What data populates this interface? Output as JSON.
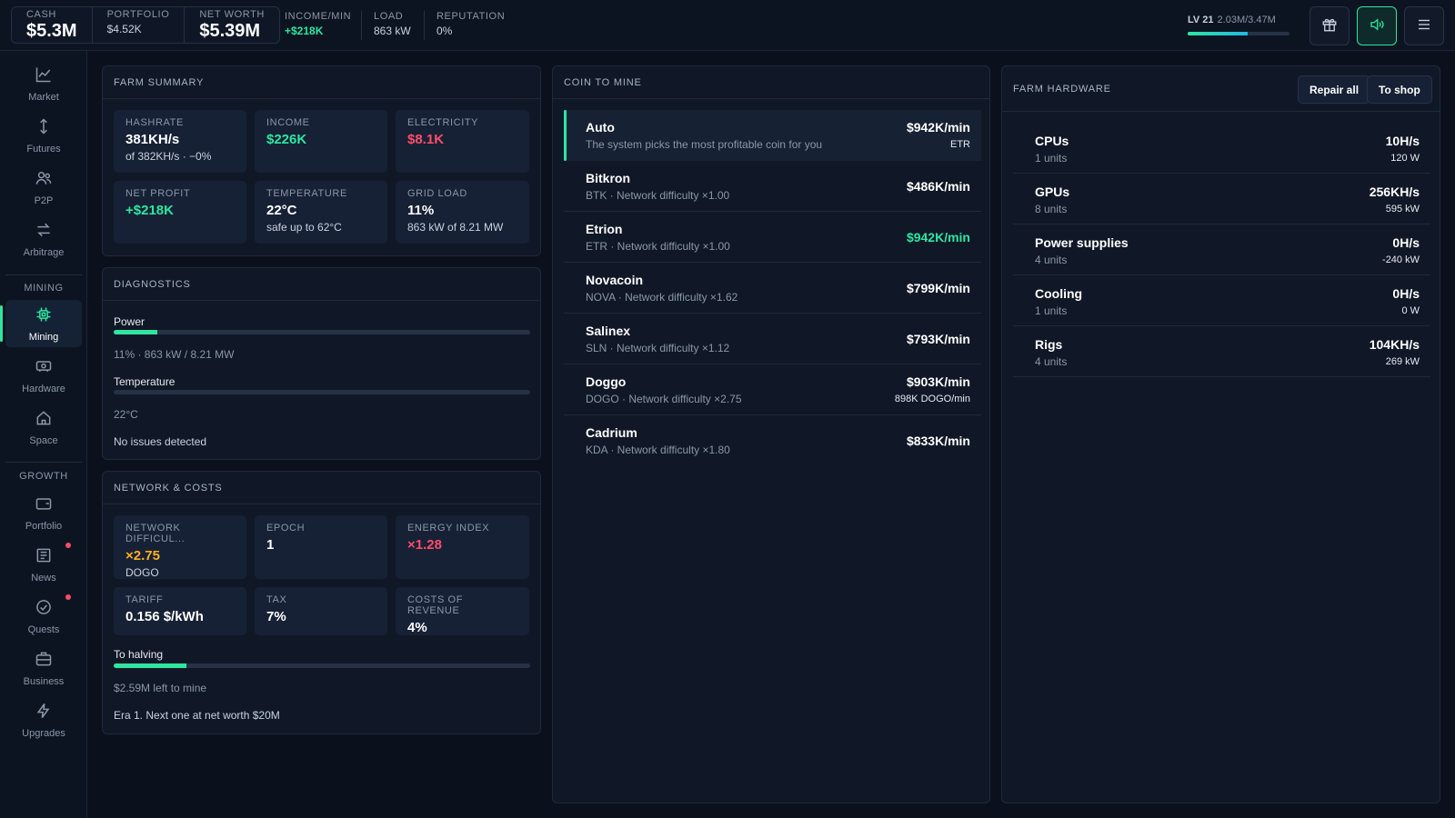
{
  "topbar": {
    "cash_label": "CASH",
    "cash_value": "$5.3M",
    "portfolio_label": "PORTFOLIO",
    "portfolio_value": "$4.52K",
    "networth_label": "NET WORTH",
    "networth_value": "$5.39M",
    "income_label": "INCOME/MIN",
    "income_value": "+$218K",
    "load_label": "LOAD",
    "load_value": "863 kW",
    "reputation_label": "REPUTATION",
    "reputation_value": "0%",
    "level_label": "LV 21",
    "level_xp": "2.03M/3.47M",
    "level_progress": 0.585
  },
  "icons": {
    "gift": "gift-icon",
    "sound": "speaker-icon",
    "menu": "menu-icon"
  },
  "sidebar": {
    "items_top": [
      {
        "label": "Market",
        "icon": "chart-icon"
      },
      {
        "label": "Futures",
        "icon": "arrows-icon"
      },
      {
        "label": "P2P",
        "icon": "users-icon"
      },
      {
        "label": "Arbitrage",
        "icon": "swap-icon"
      }
    ],
    "mining_section": "MINING",
    "items_mining": [
      {
        "label": "Mining",
        "icon": "chip-icon",
        "active": true
      },
      {
        "label": "Hardware",
        "icon": "hardware-icon"
      },
      {
        "label": "Space",
        "icon": "home-icon"
      }
    ],
    "growth_section": "GROWTH",
    "items_growth": [
      {
        "label": "Portfolio",
        "icon": "wallet-icon"
      },
      {
        "label": "News",
        "icon": "news-icon",
        "badge": true
      },
      {
        "label": "Quests",
        "icon": "check-circle-icon",
        "badge": true
      },
      {
        "label": "Business",
        "icon": "briefcase-icon"
      },
      {
        "label": "Upgrades",
        "icon": "bolt-icon"
      }
    ]
  },
  "farm_summary": {
    "title": "FARM SUMMARY",
    "hashrate_label": "HASHRATE",
    "hashrate_value": "381KH/s",
    "hashrate_sub": "of 382KH/s · −0%",
    "income_label": "INCOME",
    "income_value": "$226K",
    "electricity_label": "ELECTRICITY",
    "electricity_value": "$8.1K",
    "netprofit_label": "NET PROFIT",
    "netprofit_value": "+$218K",
    "temperature_label": "TEMPERATURE",
    "temperature_value": "22°C",
    "temperature_sub": "safe up to 62°C",
    "gridload_label": "GRID LOAD",
    "gridload_value": "11%",
    "gridload_sub": "863 kW of 8.21 MW"
  },
  "diagnostics": {
    "title": "DIAGNOSTICS",
    "power_label": "Power",
    "power_fraction": 0.105,
    "power_note": "11% · 863 kW / 8.21 MW",
    "temp_label": "Temperature",
    "temp_fraction": 0.0,
    "temp_note": "22°C",
    "message": "No issues detected"
  },
  "network": {
    "title": "NETWORK & COSTS",
    "difficulty_label": "NETWORK DIFFICUL...",
    "difficulty_value": "×2.75",
    "difficulty_sub": "DOGO",
    "epoch_label": "EPOCH",
    "epoch_value": "1",
    "energy_label": "ENERGY INDEX",
    "energy_value": "×1.28",
    "tariff_label": "TARIFF",
    "tariff_value": "0.156 $/kWh",
    "tax_label": "TAX",
    "tax_value": "7%",
    "cost_label": "COSTS OF REVENUE",
    "cost_value": "4%",
    "halving_label": "To halving",
    "halving_fraction": 0.175,
    "halving_note": "$2.59M left to mine",
    "era_note": "Era 1. Next one at net worth $20M"
  },
  "coin": {
    "title": "COIN TO MINE",
    "rows": [
      {
        "name": "Auto",
        "sub": "The system picks the most profitable coin for you",
        "rate": "$942K/min",
        "secondary": "ETR",
        "selected": true
      },
      {
        "name": "Bitkron",
        "sub": "BTK · Network difficulty ×1.00",
        "rate": "$486K/min"
      },
      {
        "name": "Etrion",
        "sub": "ETR · Network difficulty ×1.00",
        "rate": "$942K/min",
        "highlight": true
      },
      {
        "name": "Novacoin",
        "sub": "NOVA · Network difficulty ×1.62",
        "rate": "$799K/min"
      },
      {
        "name": "Salinex",
        "sub": "SLN · Network difficulty ×1.12",
        "rate": "$793K/min"
      },
      {
        "name": "Doggo",
        "sub": "DOGO · Network difficulty ×2.75",
        "rate": "$903K/min",
        "secondary": "898K DOGO/min"
      },
      {
        "name": "Cadrium",
        "sub": "KDA · Network difficulty ×1.80",
        "rate": "$833K/min"
      }
    ]
  },
  "hardware": {
    "title": "FARM HARDWARE",
    "repair_label": "Repair all",
    "shop_label": "To shop",
    "rows": [
      {
        "name": "CPUs",
        "units": "1 units",
        "rate": "10H/s",
        "power": "120 W"
      },
      {
        "name": "GPUs",
        "units": "8 units",
        "rate": "256KH/s",
        "power": "595 kW"
      },
      {
        "name": "Power supplies",
        "units": "4 units",
        "rate": "0H/s",
        "power": "-240 kW"
      },
      {
        "name": "Cooling",
        "units": "1 units",
        "rate": "0H/s",
        "power": "0 W"
      },
      {
        "name": "Rigs",
        "units": "4 units",
        "rate": "104KH/s",
        "power": "269 kW"
      }
    ]
  },
  "colors": {
    "accent": "#2ee6a0",
    "danger": "#ff4d6a",
    "warning": "#ffb020"
  }
}
